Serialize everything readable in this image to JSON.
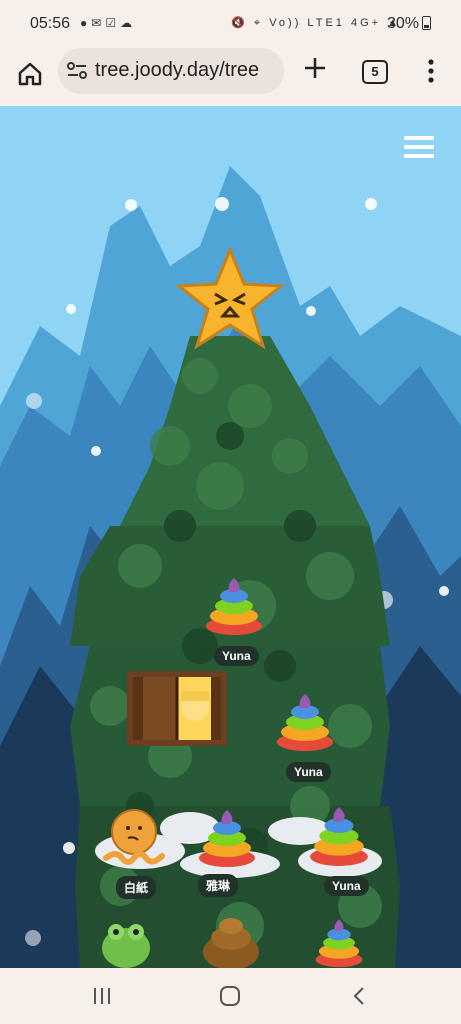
{
  "status_bar": {
    "time": "05:56",
    "left_icons": [
      "facebook-icon",
      "mail-icon",
      "check-box-icon",
      "soundcloud-icon"
    ],
    "right_icons": [
      "mute-icon",
      "location-icon",
      "volte-icon",
      "4g-icon",
      "signal-icon"
    ],
    "network_label": "Vo)) LTE1 4G+",
    "battery": "30%"
  },
  "browser": {
    "url": "tree.joody.day/tree",
    "tab_count": "5"
  },
  "game": {
    "name_tags": {
      "poop1": "Yuna",
      "poop2": "Yuna",
      "octopus": "白紙",
      "poop3": "雅琳",
      "poop4": "Yuna"
    }
  },
  "colors": {
    "sky": "#8fd4f5",
    "tree_dark": "#1f4a2e",
    "tree_mid": "#2f6b3f",
    "tree_light": "#4f8a57",
    "star": "#f7b42c",
    "tag_bg": "#20322a"
  }
}
